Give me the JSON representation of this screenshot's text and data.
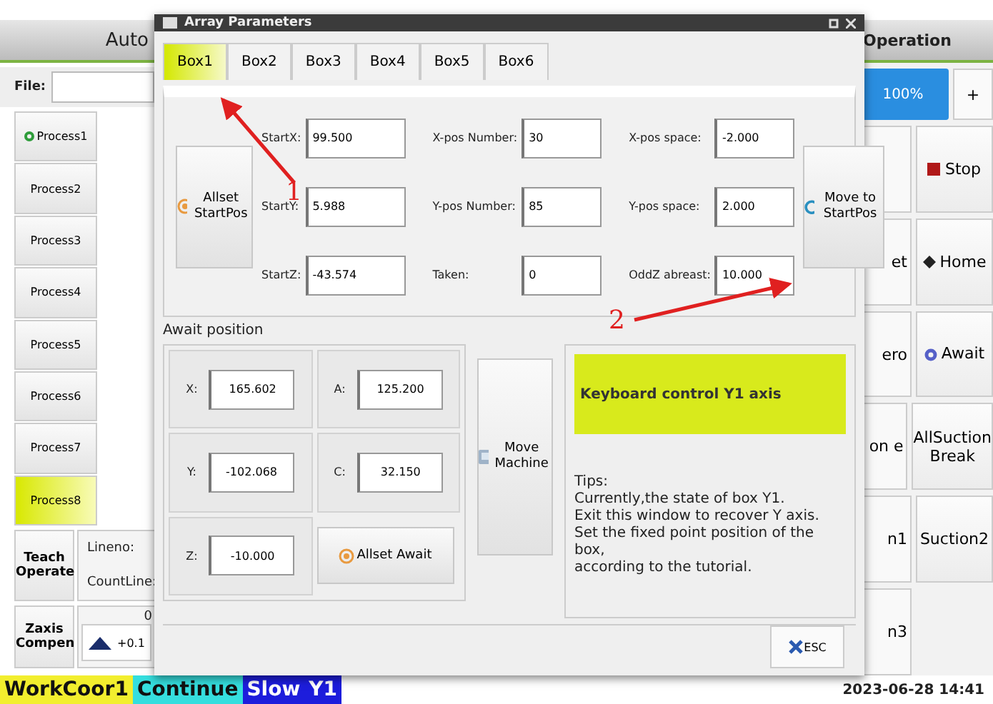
{
  "background_app": {
    "mode_header": "Auto",
    "file_label": "File:",
    "processes": [
      {
        "label": "Process1",
        "selected": false,
        "running": true
      },
      {
        "label": "Process2",
        "selected": false,
        "running": false
      },
      {
        "label": "Process3",
        "selected": false,
        "running": false
      },
      {
        "label": "Process4",
        "selected": false,
        "running": false
      },
      {
        "label": "Process5",
        "selected": false,
        "running": false
      },
      {
        "label": "Process6",
        "selected": false,
        "running": false
      },
      {
        "label": "Process7",
        "selected": false,
        "running": false
      },
      {
        "label": "Process8",
        "selected": true,
        "running": false
      }
    ],
    "teach_button": "Teach Operate",
    "lineno_label": "Lineno:",
    "countline_label": "CountLine:",
    "zaxis_button": "Zaxis Compen",
    "zaxis_value": "0",
    "zaxis_step": "+0.1",
    "operation_header": "Operation",
    "speed": "100%",
    "speed_plus": "+",
    "op_rows": [
      {
        "right": "Stop",
        "kind": "stop"
      },
      {
        "left": "et",
        "right": "Home",
        "kind": "home"
      },
      {
        "left": "ero",
        "right": "Await",
        "kind": "await"
      },
      {
        "left": "on e",
        "right": "AllSuction Break"
      },
      {
        "left": "n1",
        "right": "Suction2"
      },
      {
        "left": "n3"
      }
    ],
    "status": [
      {
        "label": "WorkCoor1",
        "color": "#f2ee2e"
      },
      {
        "label": "Continue",
        "color": "#35dede"
      },
      {
        "label": "Slow",
        "color": "#1d1ddc"
      },
      {
        "label": "Y1",
        "color": "#1d1ddc"
      }
    ],
    "datetime": "2023-06-28 14:41"
  },
  "dialog": {
    "title": "Array Parameters",
    "tabs": [
      {
        "label": "Box1",
        "selected": true
      },
      {
        "label": "Box2",
        "selected": false
      },
      {
        "label": "Box3",
        "selected": false
      },
      {
        "label": "Box4",
        "selected": false
      },
      {
        "label": "Box5",
        "selected": false
      },
      {
        "label": "Box6",
        "selected": false
      }
    ],
    "allset_startpos": "Allset StartPos",
    "fields": [
      {
        "label": "StartX:",
        "value": "99.500"
      },
      {
        "label": "X-pos Number:",
        "value": "30"
      },
      {
        "label": "X-pos space:",
        "value": "-2.000"
      },
      {
        "label": "StartY:",
        "value": "5.988"
      },
      {
        "label": "Y-pos Number:",
        "value": "85"
      },
      {
        "label": "Y-pos space:",
        "value": "2.000"
      },
      {
        "label": "StartZ:",
        "value": "-43.574"
      },
      {
        "label": "Taken:",
        "value": "0"
      },
      {
        "label": "OddZ abreast:",
        "value": "10.000"
      }
    ],
    "move_to_startpos": "Move to StartPos",
    "await_title": "Await position",
    "await_fields": [
      {
        "label": "X:",
        "value": "165.602"
      },
      {
        "label": "A:",
        "value": "125.200"
      },
      {
        "label": "Y:",
        "value": "-102.068"
      },
      {
        "label": "C:",
        "value": "32.150"
      },
      {
        "label": "Z:",
        "value": "-10.000"
      }
    ],
    "allset_await": "Allset Await",
    "move_machine": "Move Machine",
    "keyboard_banner": "Keyboard control Y1 axis",
    "tips": [
      "Tips:",
      "Currently,the state of box Y1.",
      "Exit this window to recover Y axis.",
      "Set the fixed point position of the box,",
      "according to the tutorial."
    ],
    "esc": "ESC"
  },
  "annotations": [
    {
      "label": "1"
    },
    {
      "label": "2"
    }
  ]
}
